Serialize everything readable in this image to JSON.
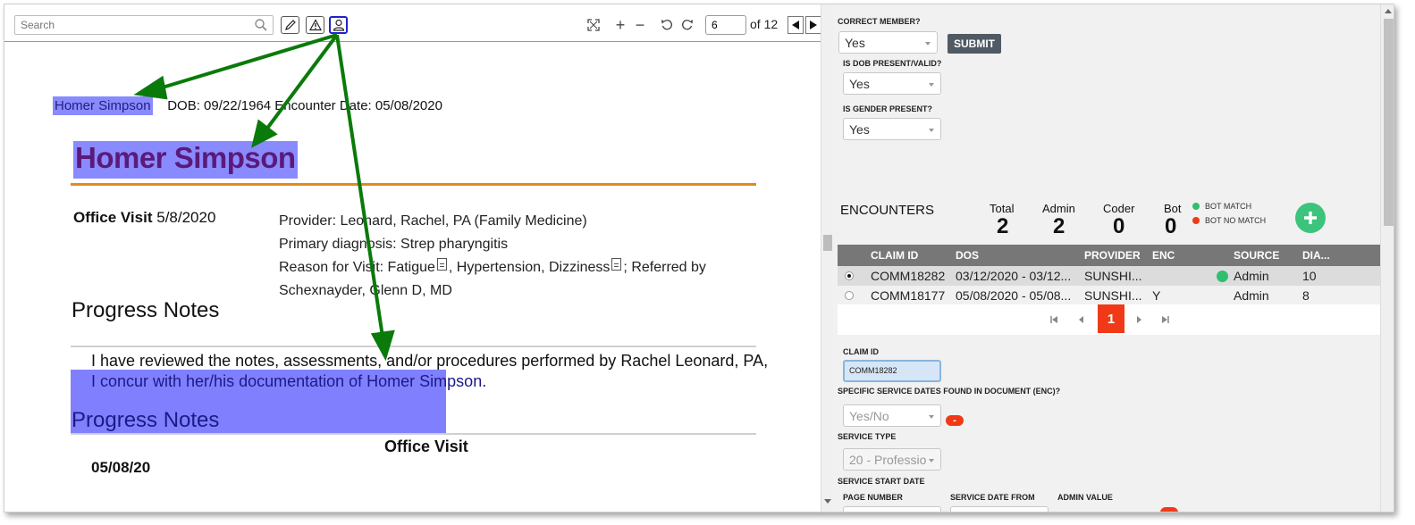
{
  "toolbar": {
    "search_placeholder": "Search",
    "page_value": "6",
    "of_label": "of 12"
  },
  "document": {
    "header_name": "Homer Simpson",
    "header_rest": "DOB: 09/22/1964 Encounter Date: 05/08/2020",
    "big_name": "Homer Simpson",
    "office_visit_label": "Office Visit",
    "office_visit_date": "5/8/2020",
    "provider_line": "Provider: Leonard, Rachel, PA (Family Medicine)",
    "diagnosis_line": "Primary diagnosis: Strep pharyngitis",
    "reason_prefix": "Reason for Visit: Fatigue",
    "reason_middle": ", Hypertension, Dizziness",
    "reason_suffix": "; Referred by",
    "referred_name": "Schexnayder, Glenn D, MD",
    "progress_notes_1": "Progress Notes",
    "review_line": "I have reviewed the notes, assessments, and/or procedures performed by Rachel Leonard, PA,",
    "concur_line": "I concur with her/his documentation of Homer Simpson.",
    "progress_notes_2": "Progress Notes",
    "office_visit_2": "Office Visit",
    "date_2": "05/08/20"
  },
  "panel": {
    "correct_member_label": "CORRECT MEMBER?",
    "correct_member_value": "Yes",
    "submit_label": "SUBMIT",
    "dob_label": "IS DOB PRESENT/VALID?",
    "dob_value": "Yes",
    "gender_label": "IS GENDER PRESENT?",
    "gender_value": "Yes",
    "encounters_title": "ENCOUNTERS",
    "stats": {
      "total_label": "Total",
      "total_value": "2",
      "admin_label": "Admin",
      "admin_value": "2",
      "coder_label": "Coder",
      "coder_value": "0",
      "bot_label": "Bot",
      "bot_value": "0"
    },
    "legend_match": "BOT MATCH",
    "legend_no_match": "BOT NO MATCH",
    "grid": {
      "headers": [
        "CLAIM ID",
        "DOS",
        "PROVIDER",
        "ENC",
        "SOURCE",
        "DIA..."
      ],
      "rows": [
        {
          "claim": "COMM18282",
          "dos": "03/12/2020 - 03/12...",
          "provider": "SUNSHI...",
          "enc": "",
          "source": "Admin",
          "dia": "10",
          "selected": true
        },
        {
          "claim": "COMM18177",
          "dos": "05/08/2020 - 05/08...",
          "provider": "SUNSHI...",
          "enc": "Y",
          "source": "Admin",
          "dia": "8",
          "selected": false
        }
      ],
      "current_page": "1"
    },
    "claim_id_label": "CLAIM ID",
    "claim_id_value": "COMM18282",
    "service_dates_label": "SPECIFIC SERVICE DATES FOUND IN DOCUMENT (ENC)?",
    "service_dates_placeholder": "Yes/No",
    "remove_label": "-",
    "service_type_label": "SERVICE TYPE",
    "service_type_value": "20 - Professio",
    "service_start_label": "SERVICE START DATE",
    "page_number_label": "PAGE NUMBER",
    "service_from_label": "SERVICE DATE FROM",
    "admin_value_label": "ADMIN VALUE"
  },
  "colors": {
    "highlight": "#8a8aff",
    "annotation_arrow": "#0a7a0a",
    "bot_match": "#2fbf6f",
    "bot_no_match": "#f03a17",
    "accent_red": "#f03a17",
    "add_button": "#3cc47c"
  }
}
